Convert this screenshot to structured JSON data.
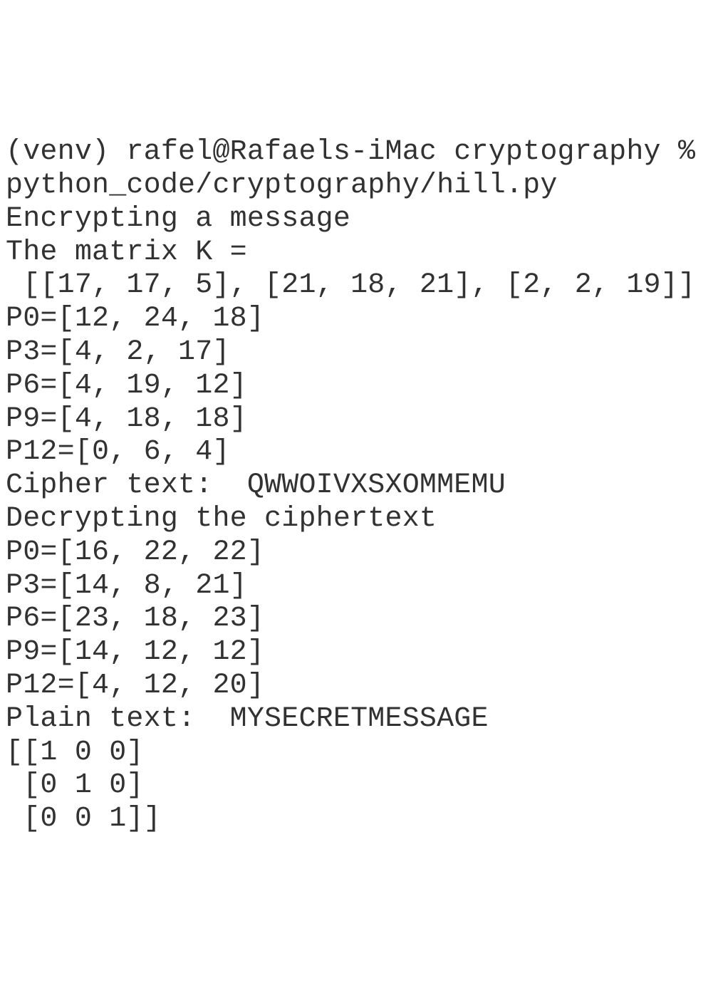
{
  "terminal": {
    "lines": [
      "(venv) rafel@Rafaels-iMac cryptography % ",
      "python_code/cryptography/hill.py",
      "Encrypting a message",
      "The matrix K = ",
      " [[17, 17, 5], [21, 18, 21], [2, 2, 19]]",
      "P0=[12, 24, 18]",
      "P3=[4, 2, 17]",
      "P6=[4, 19, 12]",
      "P9=[4, 18, 18]",
      "P12=[0, 6, 4]",
      "Cipher text:  QWWOIVXSXOMMEMU",
      "Decrypting the ciphertext",
      "P0=[16, 22, 22]",
      "P3=[14, 8, 21]",
      "P6=[23, 18, 23]",
      "P9=[14, 12, 12]",
      "P12=[4, 12, 20]",
      "Plain text:  MYSECRETMESSAGE",
      "[[1 0 0]",
      " [0 1 0]",
      " [0 0 1]]"
    ]
  }
}
